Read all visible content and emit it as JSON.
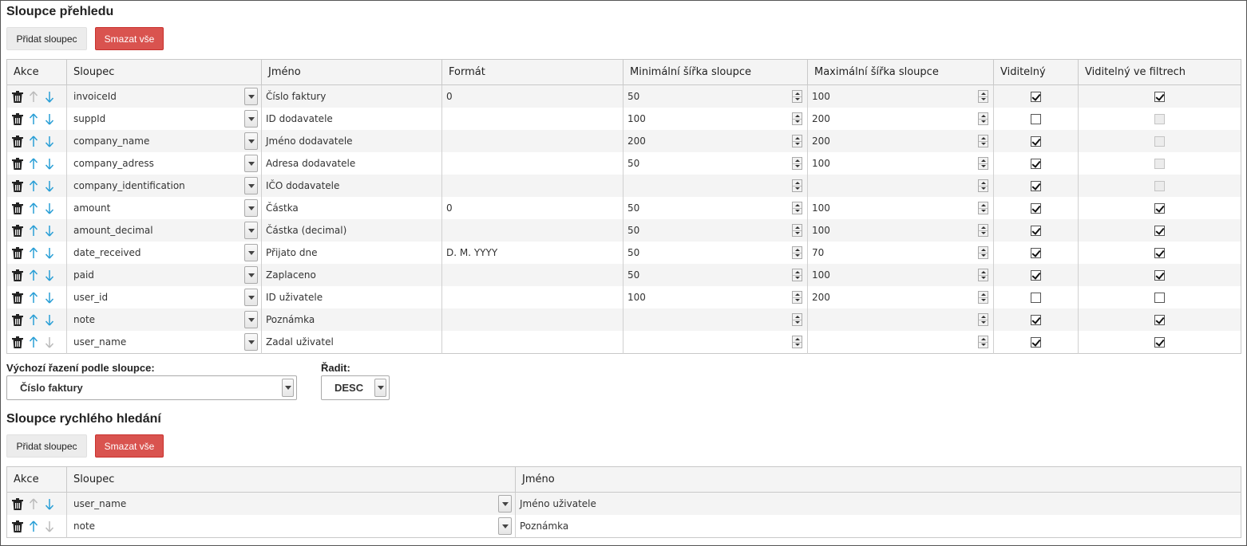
{
  "overview": {
    "title": "Sloupce přehledu",
    "add_button": "Přidat sloupec",
    "delete_all_button": "Smazat vše",
    "headers": [
      "Akce",
      "Sloupec",
      "Jméno",
      "Formát",
      "Minimální šířka sloupce",
      "Maximální šířka sloupce",
      "Viditelný",
      "Viditelný ve filtrech"
    ],
    "rows": [
      {
        "column": "invoiceId",
        "name": "Číslo faktury",
        "format": "0",
        "min_width": "50",
        "max_width": "100",
        "visible": true,
        "visible_filters": true,
        "filters_disabled": false,
        "up_enabled": false,
        "down_enabled": true
      },
      {
        "column": "suppId",
        "name": "ID dodavatele",
        "format": "",
        "min_width": "100",
        "max_width": "200",
        "visible": false,
        "visible_filters": false,
        "filters_disabled": true,
        "up_enabled": true,
        "down_enabled": true
      },
      {
        "column": "company_name",
        "name": "Jméno dodavatele",
        "format": "",
        "min_width": "200",
        "max_width": "200",
        "visible": true,
        "visible_filters": false,
        "filters_disabled": true,
        "up_enabled": true,
        "down_enabled": true
      },
      {
        "column": "company_adress",
        "name": "Adresa dodavatele",
        "format": "",
        "min_width": "50",
        "max_width": "100",
        "visible": true,
        "visible_filters": false,
        "filters_disabled": true,
        "up_enabled": true,
        "down_enabled": true
      },
      {
        "column": "company_identification",
        "name": "IČO dodavatele",
        "format": "",
        "min_width": "",
        "max_width": "",
        "visible": true,
        "visible_filters": false,
        "filters_disabled": true,
        "up_enabled": true,
        "down_enabled": true
      },
      {
        "column": "amount",
        "name": "Částka",
        "format": "0",
        "min_width": "50",
        "max_width": "100",
        "visible": true,
        "visible_filters": true,
        "filters_disabled": false,
        "up_enabled": true,
        "down_enabled": true
      },
      {
        "column": "amount_decimal",
        "name": "Částka (decimal)",
        "format": "",
        "min_width": "50",
        "max_width": "100",
        "visible": true,
        "visible_filters": true,
        "filters_disabled": false,
        "up_enabled": true,
        "down_enabled": true
      },
      {
        "column": "date_received",
        "name": "Přijato dne",
        "format": "D. M. YYYY",
        "min_width": "50",
        "max_width": "70",
        "visible": true,
        "visible_filters": true,
        "filters_disabled": false,
        "up_enabled": true,
        "down_enabled": true
      },
      {
        "column": "paid",
        "name": "Zaplaceno",
        "format": "",
        "min_width": "50",
        "max_width": "100",
        "visible": true,
        "visible_filters": true,
        "filters_disabled": false,
        "up_enabled": true,
        "down_enabled": true
      },
      {
        "column": "user_id",
        "name": "ID uživatele",
        "format": "",
        "min_width": "100",
        "max_width": "200",
        "visible": false,
        "visible_filters": false,
        "filters_disabled": false,
        "up_enabled": true,
        "down_enabled": true
      },
      {
        "column": "note",
        "name": "Poznámka",
        "format": "",
        "min_width": "",
        "max_width": "",
        "visible": true,
        "visible_filters": true,
        "filters_disabled": false,
        "up_enabled": true,
        "down_enabled": true
      },
      {
        "column": "user_name",
        "name": "Zadal uživatel",
        "format": "",
        "min_width": "",
        "max_width": "",
        "visible": true,
        "visible_filters": true,
        "filters_disabled": false,
        "up_enabled": true,
        "down_enabled": false
      }
    ]
  },
  "sort": {
    "label": "Výchozí řazení podle sloupce:",
    "value": "Číslo faktury",
    "order_label": "Řadit:",
    "order_value": "DESC"
  },
  "quick_search": {
    "title": "Sloupce rychlého hledání",
    "add_button": "Přidat sloupec",
    "delete_all_button": "Smazat vše",
    "headers": [
      "Akce",
      "Sloupec",
      "Jméno"
    ],
    "rows": [
      {
        "column": "user_name",
        "name": "Jméno uživatele",
        "up_enabled": false,
        "down_enabled": true
      },
      {
        "column": "note",
        "name": "Poznámka",
        "up_enabled": true,
        "down_enabled": false
      }
    ]
  },
  "colors": {
    "accent_arrow": "#2a9fd6",
    "disabled_arrow": "#bbbbbb",
    "danger": "#d9534f"
  },
  "icons": {
    "delete": "trash-icon",
    "move_up": "arrow-up-icon",
    "move_down": "arrow-down-icon",
    "dropdown": "chevron-down-icon",
    "spinner": "spinner-arrows-icon"
  }
}
